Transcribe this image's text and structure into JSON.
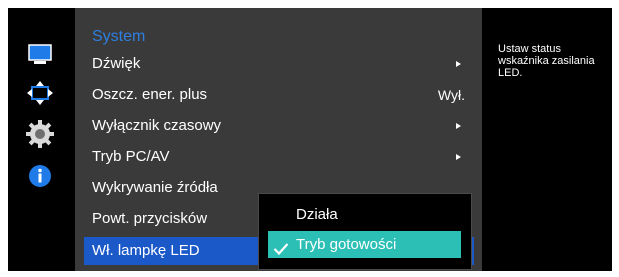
{
  "icon_sidebar": [
    {
      "icon": "monitor-icon"
    },
    {
      "icon": "move-arrows-icon"
    },
    {
      "icon": "gear-icon"
    },
    {
      "icon": "info-icon"
    }
  ],
  "menu": {
    "title": "System",
    "items": [
      {
        "label": "Dźwięk",
        "value": "",
        "has_submenu": true
      },
      {
        "label": "Oszcz. ener. plus",
        "value": "Wył.",
        "has_submenu": false
      },
      {
        "label": "Wyłącznik czasowy",
        "value": "",
        "has_submenu": true
      },
      {
        "label": "Tryb PC/AV",
        "value": "",
        "has_submenu": true
      },
      {
        "label": "Wykrywanie źródła",
        "value": "",
        "has_submenu": false
      },
      {
        "label": "Powt. przycisków",
        "value": "",
        "has_submenu": false
      },
      {
        "label": "Wł. lampkę LED",
        "value": "",
        "has_submenu": false,
        "selected": true
      }
    ]
  },
  "submenu": {
    "options": [
      {
        "label": "Działa",
        "selected": false
      },
      {
        "label": "Tryb gotowości",
        "selected": true
      }
    ]
  },
  "help": {
    "text": "Ustaw status wskaźnika zasilania LED."
  },
  "colors": {
    "title_blue": "#2e7fe0",
    "selected_row": "#1b59c9",
    "selected_option": "#2bbfb6",
    "menu_bg": "#3a3a3a",
    "frame_bg": "#000000"
  }
}
